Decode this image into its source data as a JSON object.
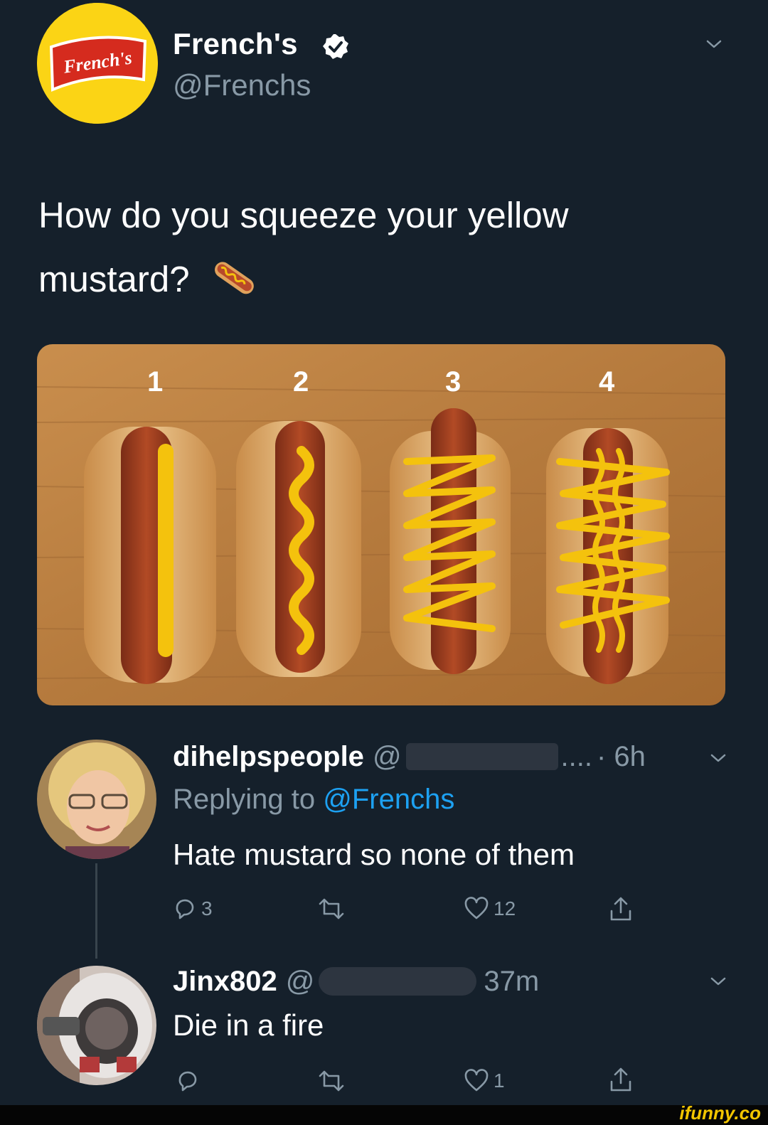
{
  "main_tweet": {
    "author_name": "French's",
    "author_handle": "@Frenchs",
    "logo_text": "French's",
    "text": "How do you squeeze your yellow mustard?",
    "emoji": "hot-dog",
    "image": {
      "labels": [
        "1",
        "2",
        "3",
        "4"
      ]
    }
  },
  "replies": [
    {
      "username": "dihelpspeople",
      "at": "@",
      "handle_tail": "....",
      "time": "· 6h",
      "replying_prefix": "Replying to ",
      "replying_to": "@Frenchs",
      "text": "Hate mustard so none of them",
      "reply_count": "3",
      "retweet_count": "",
      "like_count": "12"
    },
    {
      "username": "Jinx802",
      "at": "@",
      "time": "37m",
      "text": "Die in a fire",
      "reply_count": "",
      "retweet_count": "",
      "like_count": "1"
    }
  ],
  "watermark": "ifunny.co",
  "colors": {
    "background": "#15202b",
    "text": "#ffffff",
    "secondary": "#8899a6",
    "link": "#1da1f2",
    "mustard": "#f4c20d",
    "watermark": "#f2c500"
  },
  "icons": [
    "verified-badge-icon",
    "chevron-down-icon",
    "reply-icon",
    "retweet-icon",
    "like-icon",
    "share-icon"
  ]
}
